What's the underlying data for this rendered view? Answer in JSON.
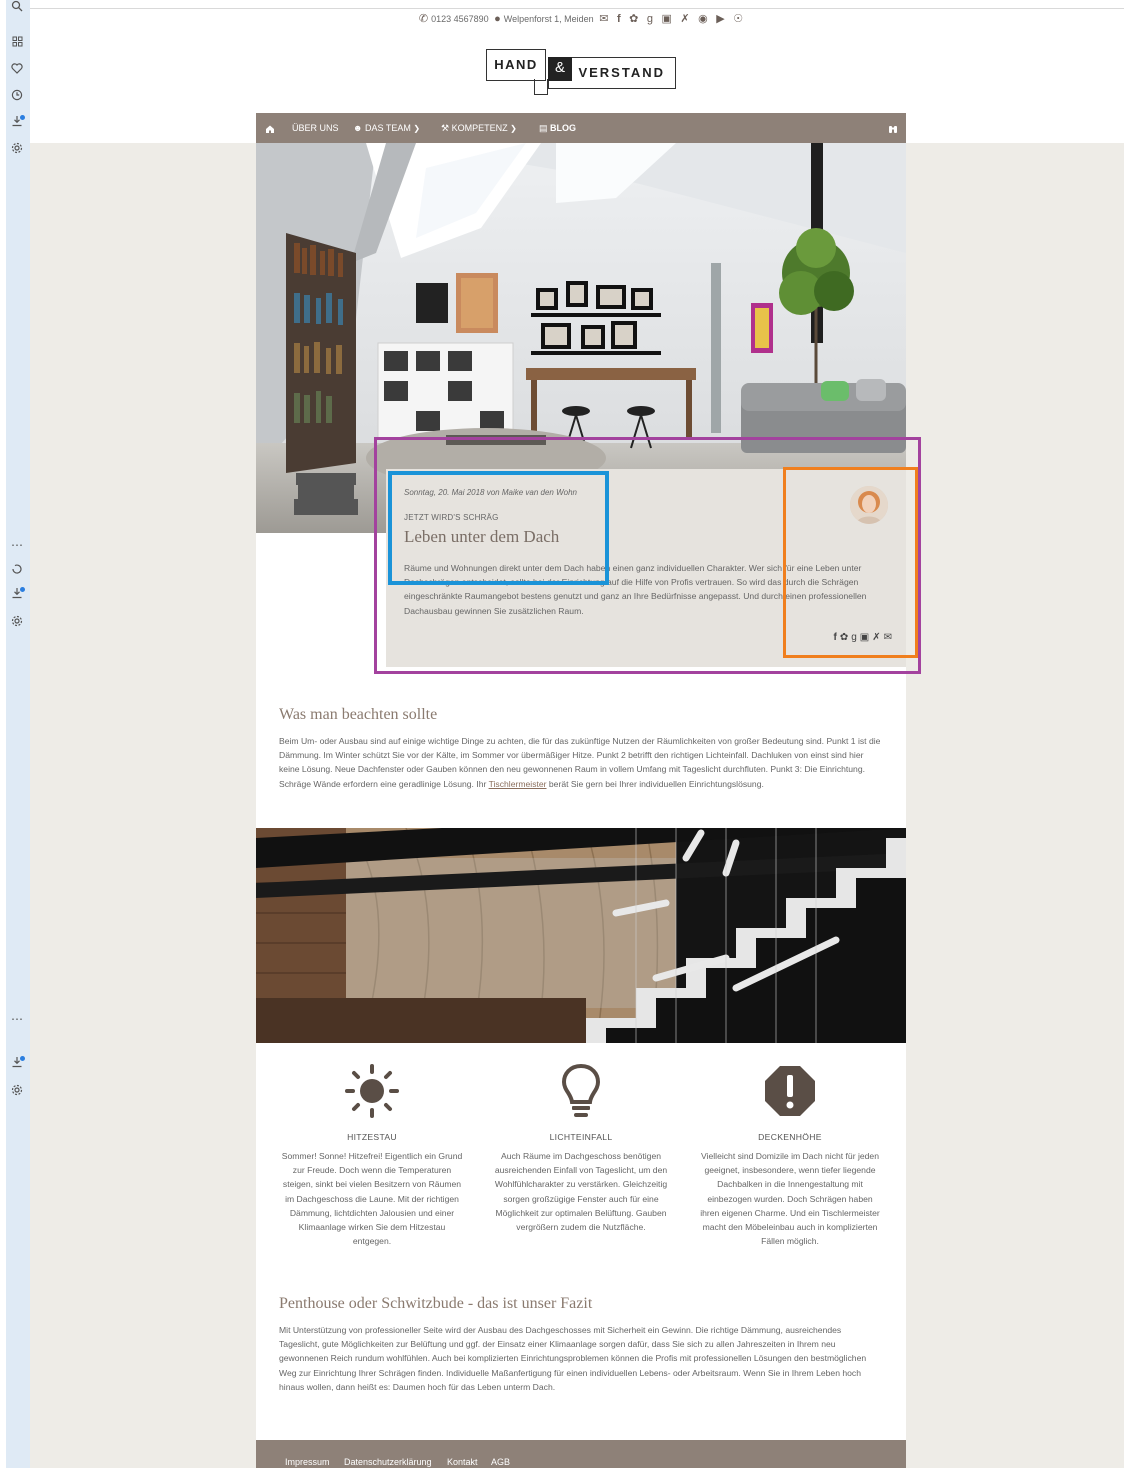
{
  "contact": {
    "phone": "0123 4567890",
    "address": "Welpenforst 1, Meiden",
    "social_icons": [
      "mail-icon",
      "facebook-icon",
      "twitter-icon",
      "google-plus-icon",
      "linkedin-icon",
      "xing-icon",
      "instagram-icon",
      "youtube-icon",
      "pinterest-icon"
    ]
  },
  "logo": {
    "word1": "HAND",
    "amp": "&",
    "word2": "VERSTAND"
  },
  "nav": {
    "items": [
      {
        "label": "ÜBER UNS",
        "icon": "home-icon"
      },
      {
        "label": "DAS TEAM",
        "icon": "team-icon"
      },
      {
        "label": "KOMPETENZ",
        "icon": "competence-icon"
      },
      {
        "label": "BLOG",
        "icon": "blog-icon"
      }
    ],
    "right_icon": "binoculars-icon"
  },
  "article": {
    "meta": "Sonntag, 20. Mai 2018 von Maike van den Wohn",
    "kicker": "JETZT WIRD'S SCHRÄG",
    "title": "Leben unter dem Dach",
    "body": "Räume und Wohnungen direkt unter dem Dach haben einen ganz individuellen Charakter. Wer sich für eine Leben unter Dachschrägen entscheidet, sollte bei der Einrichtung auf die Hilfe von Profis vertrauen. So wird das durch die Schrägen eingeschränkte Raumangebot bestens genutzt und ganz an Ihre Bedürfnisse angepasst. Und durch einen professionellen Dachausbau gewinnen Sie zusätzlichen Raum.",
    "share_icons": [
      "facebook-icon",
      "twitter-icon",
      "google-plus-icon",
      "linkedin-icon",
      "xing-icon",
      "mail-icon"
    ]
  },
  "section1": {
    "heading": "Was man beachten sollte",
    "text_before_link": "Beim Um- oder Ausbau sind auf einige wichtige Dinge zu achten, die für das zukünftige Nutzen der Räumlichkeiten von großer Bedeutung sind. Punkt 1 ist die Dämmung. Im Winter schützt Sie vor der Kälte, im Sommer vor übermäßiger Hitze. Punkt 2 betrifft den richtigen Lichteinfall. Dachluken von einst sind hier keine Lösung. Neue Dachfenster oder Gauben können den neu gewonnenen Raum in vollem Umfang mit Tageslicht durchfluten. Punkt 3: Die Einrichtung. Schräge Wände erfordern eine geradlinige Lösung. Ihr ",
    "link": "Tischlermeister",
    "text_after_link": " berät Sie gern bei Ihrer individuellen Einrichtungslösung."
  },
  "features": [
    {
      "icon": "sun-icon",
      "title": "HITZESTAU",
      "text": "Sommer! Sonne! Hitzefrei! Eigentlich ein Grund zur Freude. Doch wenn die Temperaturen steigen, sinkt bei vielen Besitzern von Räumen im Dachgeschoss die Laune. Mit der richtigen Dämmung, lichtdichten Jalousien und einer Klimaanlage wirken Sie dem Hitzestau entgegen."
    },
    {
      "icon": "lightbulb-icon",
      "title": "LICHTEINFALL",
      "text": "Auch Räume im Dachgeschoss benötigen ausreichenden Einfall von Tageslicht, um den Wohlfühlcharakter zu verstärken. Gleichzeitig sorgen großzügige Fenster auch für eine Möglichkeit zur optimalen Belüftung. Gauben vergrößern zudem die Nutzfläche."
    },
    {
      "icon": "warning-icon",
      "title": "DECKENHÖHE",
      "text": "Vielleicht sind Domizile im Dach nicht für jeden geeignet, insbesondere, wenn tiefer liegende Dachbalken in die Innengestaltung mit einbezogen wurden. Doch Schrägen haben ihren eigenen Charme. Und ein Tischlermeister macht den Möbeleinbau auch in komplizierten Fällen möglich."
    }
  ],
  "section2": {
    "heading": "Penthouse oder Schwitzbude - das ist unser Fazit",
    "text": "Mit Unterstützung von professioneller Seite wird der Ausbau des Dachgeschosses mit Sicherheit ein Gewinn. Die richtige Dämmung, ausreichendes Tageslicht, gute Möglichkeiten zur Belüftung und ggf. der Einsatz einer Klimaanlage sorgen dafür, dass Sie sich zu allen Jahreszeiten in Ihrem neu gewonnenen Reich rundum wohlfühlen. Auch bei komplizierten Einrichtungsproblemen können die Profis mit professionellen Lösungen den bestmöglichen Weg zur Einrichtung Ihrer Schrägen finden. Individuelle Maßanfertigung für einen individuellen Lebens- oder Arbeitsraum. Wenn Sie in Ihrem Leben hoch hinaus wollen, dann heißt es: Daumen hoch für das Leben unterm Dach."
  },
  "footer": {
    "links": [
      "Impressum",
      "Datenschutzerklärung",
      "Kontakt",
      "AGB"
    ]
  },
  "browser_rail": {
    "icons": [
      "search-icon",
      "apps-icon",
      "heart-icon",
      "history-icon",
      "download-icon",
      "settings-icon",
      "more-icon",
      "refresh-icon",
      "download-icon",
      "settings-icon",
      "more-icon",
      "download-icon",
      "settings-icon"
    ]
  },
  "colors": {
    "nav_bg": "#8e8178",
    "page_bg": "#eeece7",
    "card_bg": "#e6e3de",
    "heading": "#8a7a6f",
    "overlay_purple": "#a3429e",
    "overlay_blue": "#1a93d8",
    "overlay_orange": "#f07f1e"
  }
}
